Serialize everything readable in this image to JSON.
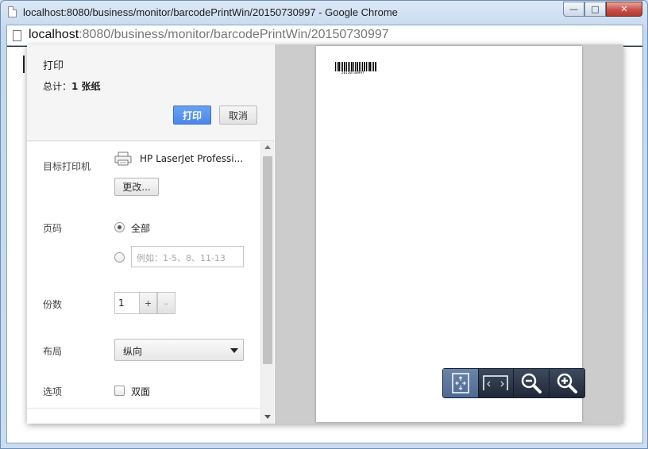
{
  "window": {
    "title": "localhost:8080/business/monitor/barcodePrintWin/20150730997 - Google Chrome",
    "minimize_glyph": "—",
    "maximize_glyph": "□",
    "close_glyph": "✕"
  },
  "address": {
    "host": "localhost",
    "path": ":8080/business/monitor/barcodePrintWin/20150730997"
  },
  "print": {
    "title": "打印",
    "total_label": "总计：",
    "total_value": "1 张纸",
    "print_button": "打印",
    "cancel_button": "取消",
    "destination_label": "目标打印机",
    "printer_name": "HP LaserJet Professi...",
    "change_button": "更改...",
    "pages_label": "页码",
    "pages_all": "全部",
    "pages_range_placeholder": "例如：1-5、8、11-13",
    "copies_label": "份数",
    "copies_value": "1",
    "plus": "+",
    "minus": "–",
    "layout_label": "布局",
    "layout_value": "纵向",
    "options_label": "选项",
    "duplex_label": "双面"
  },
  "preview": {
    "barcode_text": "20150730997",
    "zoom_controls": [
      "fit-to-page-icon",
      "fit-to-width-icon",
      "zoom-out-icon",
      "zoom-in-icon"
    ]
  },
  "colors": {
    "print_button": "#4a87ea",
    "preview_background": "#cccccc",
    "zoom_bar": "#2a3446"
  }
}
